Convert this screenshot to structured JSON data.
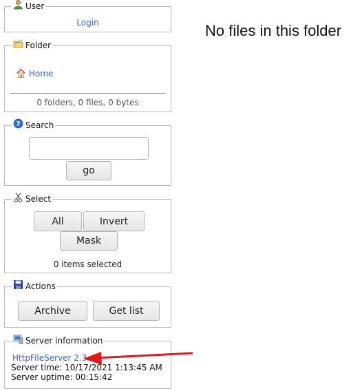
{
  "user": {
    "title": "User",
    "login_label": "Login"
  },
  "folder": {
    "title": "Folder",
    "home_label": "Home",
    "summary": "0 folders, 0 files, 0 bytes"
  },
  "search": {
    "title": "Search",
    "input_value": "",
    "go_label": "go"
  },
  "select": {
    "title": "Select",
    "all_label": "All",
    "invert_label": "Invert",
    "mask_label": "Mask",
    "selected_text": "0 items selected"
  },
  "actions": {
    "title": "Actions",
    "archive_label": "Archive",
    "getlist_label": "Get list"
  },
  "server": {
    "title": "Server information",
    "version_link": "HttpFileServer 2.3",
    "server_time": "Server time: 10/17/2021 1:13:45 AM",
    "server_uptime": "Server uptime: 00:15:42"
  },
  "main": {
    "empty_message": "No files in this folder"
  },
  "icons": {
    "user": "user-icon",
    "folder": "folder-icon",
    "home": "home-icon",
    "search": "help-icon",
    "select": "scissors-icon",
    "actions": "save-icon",
    "server": "server-icon"
  },
  "colors": {
    "link": "#3a60c8",
    "arrow": "#e0191b"
  }
}
